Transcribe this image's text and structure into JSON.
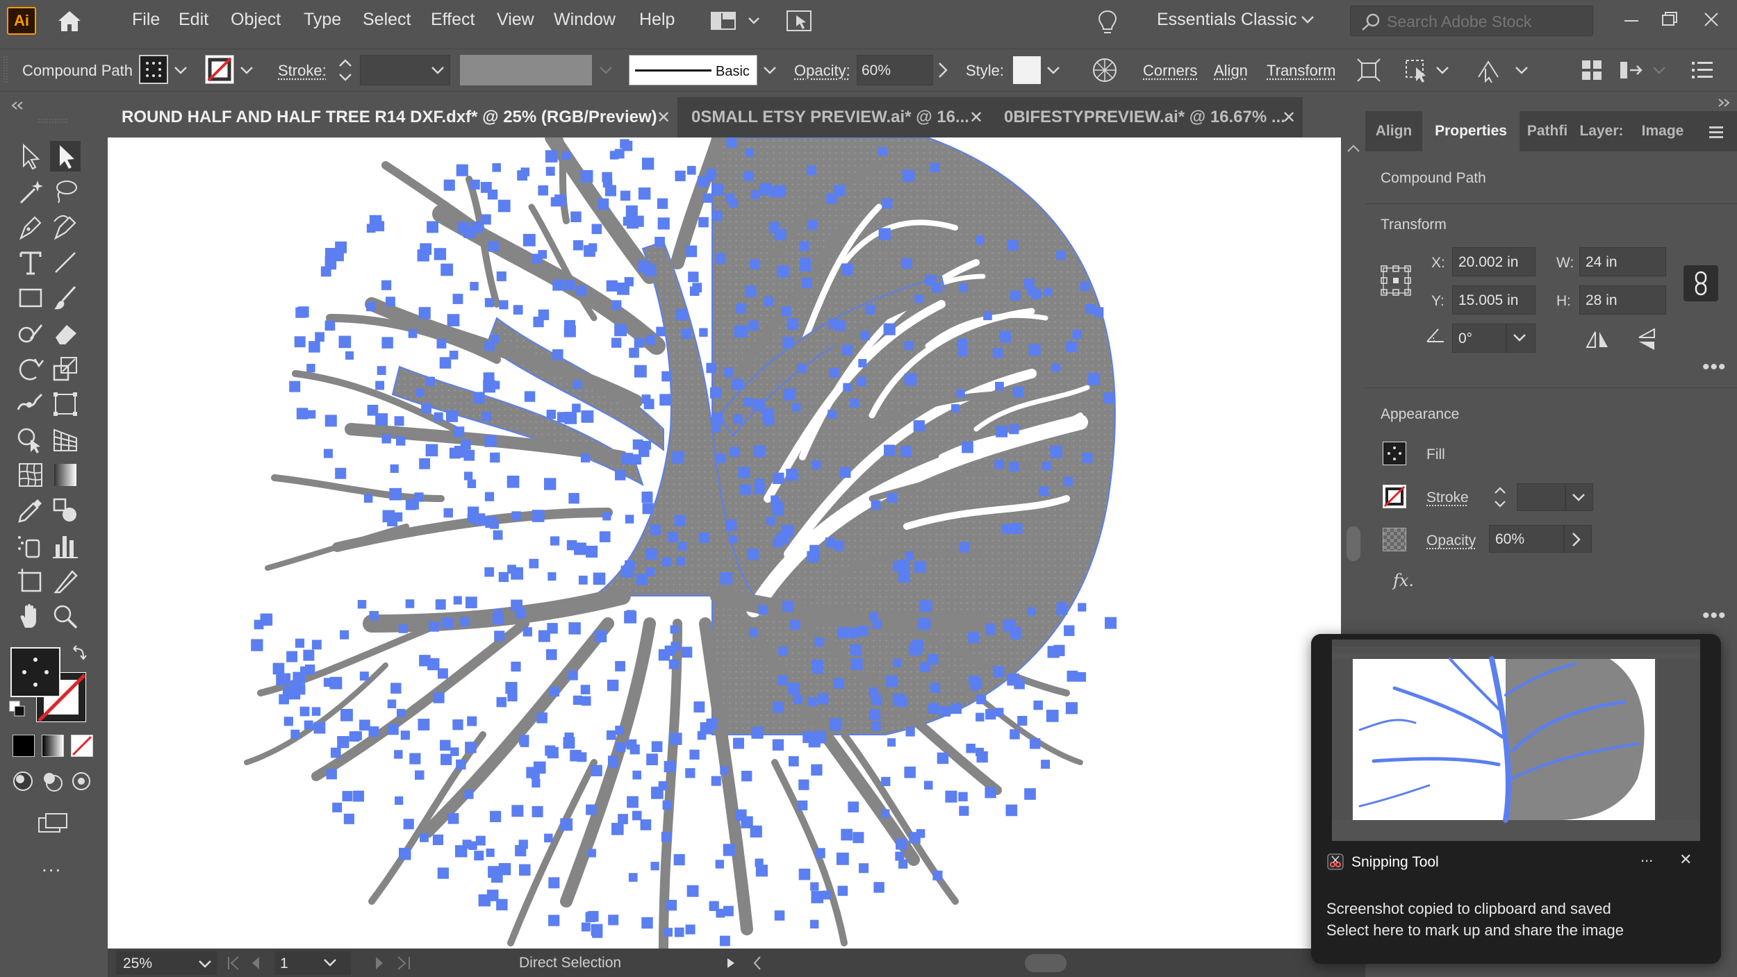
{
  "app": {
    "logo": "Ai",
    "menu": [
      "File",
      "Edit",
      "Object",
      "Type",
      "Select",
      "Effect",
      "View",
      "Window",
      "Help"
    ],
    "workspace": "Essentials Classic",
    "search_placeholder": "Search Adobe Stock"
  },
  "control_bar": {
    "selection_type": "Compound Path",
    "stroke_label": "Stroke:",
    "stroke_style": "Basic",
    "opacity_label": "Opacity:",
    "opacity_value": "60%",
    "style_label": "Style:",
    "corners": "Corners",
    "align": "Align",
    "transform": "Transform"
  },
  "tabs": [
    {
      "label": "ROUND HALF AND HALF TREE R14 DXF.dxf* @ 25% (RGB/Preview)",
      "active": true
    },
    {
      "label": "0SMALL ETSY PREVIEW.ai* @ 16...",
      "active": false
    },
    {
      "label": "0BIFESTYPREVIEW.ai* @ 16.67% ...",
      "active": false
    }
  ],
  "toolbar": {
    "tools": [
      "direct-selection",
      "selection",
      "magic-wand",
      "lasso",
      "pen",
      "curvature",
      "type",
      "line",
      "rectangle",
      "paintbrush",
      "shaper",
      "eraser",
      "rotate",
      "scale",
      "warp",
      "free-transform",
      "shape-builder",
      "perspective-grid",
      "mesh",
      "gradient",
      "eyedropper",
      "blend",
      "symbol-sprayer",
      "column-graph",
      "artboard",
      "slice",
      "hand",
      "zoom"
    ],
    "more": "..."
  },
  "status_bar": {
    "zoom": "25%",
    "artboard_number": "1",
    "current_tool": "Direct Selection"
  },
  "panel": {
    "tabs": [
      "Align",
      "Properties",
      "Pathfi",
      "Layer:",
      "Image"
    ],
    "active_tab": "Properties",
    "selection_type": "Compound Path",
    "transform_title": "Transform",
    "x_label": "X:",
    "x_value": "20.002 in",
    "y_label": "Y:",
    "y_value": "15.005 in",
    "w_label": "W:",
    "w_value": "24 in",
    "h_label": "H:",
    "h_value": "28 in",
    "angle_value": "0°",
    "appearance_title": "Appearance",
    "fill_label": "Fill",
    "stroke_label": "Stroke",
    "opacity_label": "Opacity",
    "opacity_value": "60%",
    "fx_label": "fx."
  },
  "notification": {
    "app_name": "Snipping Tool",
    "line1": "Screenshot copied to clipboard and saved",
    "line2": "Select here to mark up and share the image",
    "more": "...",
    "close": "✕"
  },
  "colors": {
    "ui_bg": "#535353",
    "tab_bg": "#424242",
    "selection_blue": "#5b7ff0",
    "artwork_gray": "#858585",
    "ai_orange": "#ff9a00",
    "none_red": "#e0262b"
  }
}
